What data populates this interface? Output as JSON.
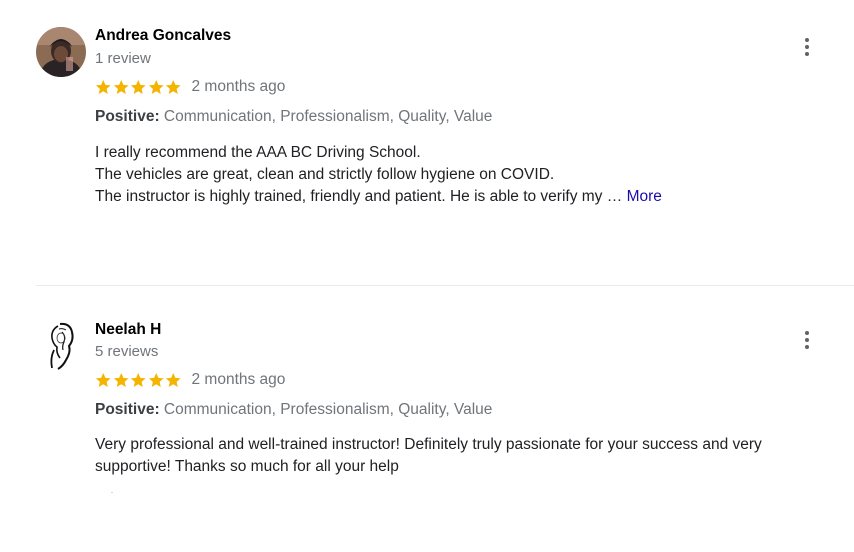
{
  "colors": {
    "star": "#f4b400",
    "link": "#1a0dab",
    "muted_text": "#70757a",
    "body_text": "#202124"
  },
  "reviews": [
    {
      "author": "Andrea Goncalves",
      "meta": "1 review",
      "rating": 5,
      "date": "2 months ago",
      "attributes_label": "Positive:",
      "attributes_value": "Communication, Professionalism, Quality, Value",
      "text_lines": [
        "I really recommend the AAA BC Driving School.",
        "The vehicles are great, clean and strictly follow hygiene on COVID.",
        "The instructor is highly trained, friendly and patient. He is able to verify my …"
      ],
      "more_label": "More",
      "avatar_icon": "profile-photo",
      "menu_icon": "more-vert-icon"
    },
    {
      "author": "Neelah H",
      "meta": "5 reviews",
      "rating": 5,
      "date": "2 months ago",
      "attributes_label": "Positive:",
      "attributes_value": "Communication, Professionalism, Quality, Value",
      "text_lines": [
        "Very professional and well-trained instructor! Definitely truly passionate for your success and very",
        "supportive! Thanks so much for all your help"
      ],
      "avatar_icon": "sketch-portrait",
      "menu_icon": "more-vert-icon"
    }
  ]
}
